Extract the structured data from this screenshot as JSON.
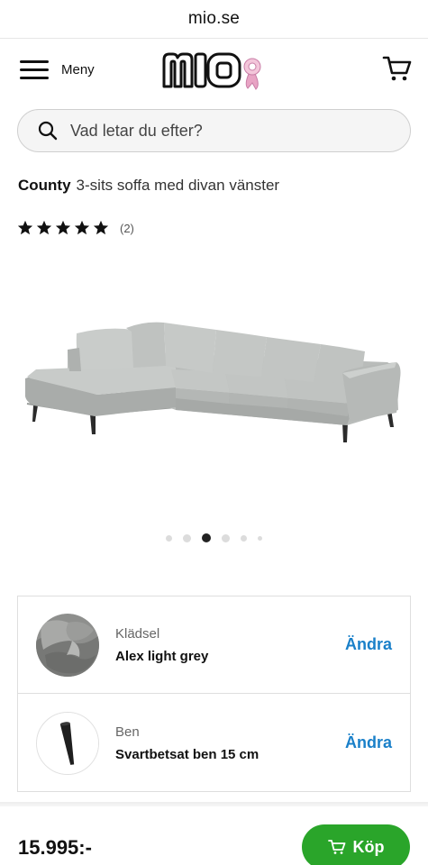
{
  "browser": {
    "url": "mio.se"
  },
  "header": {
    "menu_label": "Meny",
    "logo_text": "MIO",
    "menu_icon": "hamburger-menu-icon",
    "cart_icon": "shopping-cart-icon"
  },
  "search": {
    "placeholder": "Vad letar du efter?",
    "value": ""
  },
  "product": {
    "brand": "County",
    "subtitle": "3-sits soffa med divan vänster",
    "rating": 5,
    "max_rating": 5,
    "review_count": "(2)",
    "carousel": {
      "count": 6,
      "active_index": 2
    }
  },
  "options": [
    {
      "label": "Klädsel",
      "value": "Alex light grey",
      "action": "Ändra",
      "icon": "fabric-swatch-icon"
    },
    {
      "label": "Ben",
      "value": "Svartbetsat ben 15 cm",
      "action": "Ändra",
      "icon": "sofa-leg-icon"
    }
  ],
  "footer": {
    "price": "15.995:-",
    "buy_label": "Köp",
    "buy_icon": "cart-icon"
  },
  "colors": {
    "accent_blue": "#1a80c9",
    "buy_green": "#2aa52a",
    "logo_pink": "#e8a4c4"
  }
}
